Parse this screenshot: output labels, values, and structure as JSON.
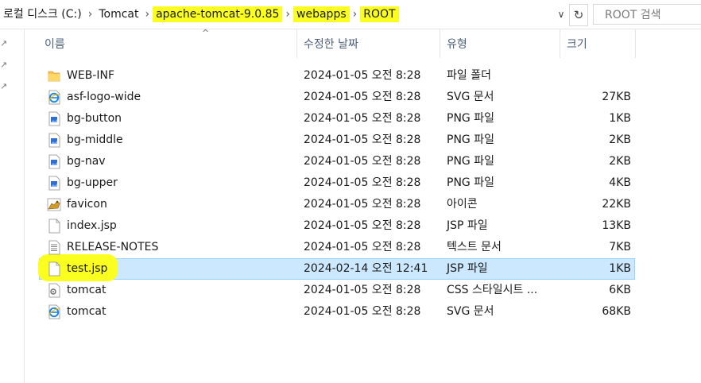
{
  "address": {
    "crumbs": [
      {
        "label": "로컬 디스크 (C:)",
        "highlight": false
      },
      {
        "label": "Tomcat",
        "highlight": false
      },
      {
        "label": "apache-tomcat-9.0.85",
        "highlight": true
      },
      {
        "label": "webapps",
        "highlight": true
      },
      {
        "label": "ROOT",
        "highlight": true
      }
    ],
    "separator": "›",
    "dropdown_icon": "chevron-down-icon",
    "refresh_icon": "refresh-icon",
    "search_placeholder": "ROOT 검색"
  },
  "columns": {
    "name": "이름",
    "date": "수정한 날짜",
    "type": "유형",
    "size": "크기",
    "sort_indicator": "^"
  },
  "files": [
    {
      "name": "WEB-INF",
      "date": "2024-01-05 오전 8:28",
      "type": "파일 폴더",
      "size": "",
      "icon": "folder-icon"
    },
    {
      "name": "asf-logo-wide",
      "date": "2024-01-05 오전 8:28",
      "type": "SVG 문서",
      "size": "27KB",
      "icon": "ie-document-icon"
    },
    {
      "name": "bg-button",
      "date": "2024-01-05 오전 8:28",
      "type": "PNG 파일",
      "size": "1KB",
      "icon": "image-file-icon"
    },
    {
      "name": "bg-middle",
      "date": "2024-01-05 오전 8:28",
      "type": "PNG 파일",
      "size": "2KB",
      "icon": "image-file-icon"
    },
    {
      "name": "bg-nav",
      "date": "2024-01-05 오전 8:28",
      "type": "PNG 파일",
      "size": "2KB",
      "icon": "image-file-icon"
    },
    {
      "name": "bg-upper",
      "date": "2024-01-05 오전 8:28",
      "type": "PNG 파일",
      "size": "4KB",
      "icon": "image-file-icon"
    },
    {
      "name": "favicon",
      "date": "2024-01-05 오전 8:28",
      "type": "아이콘",
      "size": "22KB",
      "icon": "tomcat-icon"
    },
    {
      "name": "index.jsp",
      "date": "2024-01-05 오전 8:28",
      "type": "JSP 파일",
      "size": "13KB",
      "icon": "blank-file-icon"
    },
    {
      "name": "RELEASE-NOTES",
      "date": "2024-01-05 오전 8:28",
      "type": "텍스트 문서",
      "size": "7KB",
      "icon": "text-file-icon"
    },
    {
      "name": "test.jsp",
      "date": "2024-02-14 오전 12:41",
      "type": "JSP 파일",
      "size": "1KB",
      "icon": "blank-file-icon",
      "selected": true,
      "highlight": true
    },
    {
      "name": "tomcat",
      "date": "2024-01-05 오전 8:28",
      "type": "CSS 스타일시트 ...",
      "size": "6KB",
      "icon": "css-file-icon"
    },
    {
      "name": "tomcat",
      "date": "2024-01-05 오전 8:28",
      "type": "SVG 문서",
      "size": "68KB",
      "icon": "ie-document-icon"
    }
  ],
  "colors": {
    "highlight": "#fbff1f",
    "selection_bg": "#cce8ff",
    "selection_border": "#99d1ff",
    "header_text": "#4c607a"
  }
}
